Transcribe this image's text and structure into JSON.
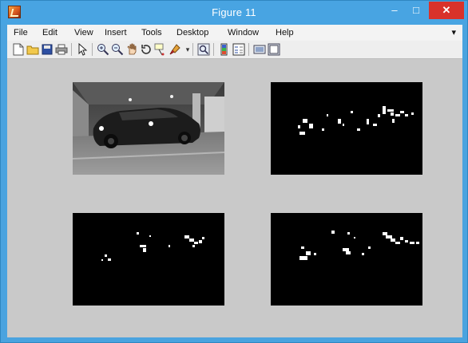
{
  "window": {
    "title": "Figure 11",
    "minimize_label": "–",
    "maximize_label": "□",
    "close_label": "✕"
  },
  "menu": {
    "items": [
      "File",
      "Edit",
      "View",
      "Insert",
      "Tools",
      "Desktop",
      "Window",
      "Help"
    ],
    "overflow_arrow": "▾"
  },
  "toolbar": {
    "icons": [
      "new-figure-icon",
      "open-file-icon",
      "save-icon",
      "print-icon",
      "edit-plot-arrow-icon",
      "zoom-in-icon",
      "zoom-out-icon",
      "pan-icon",
      "rotate-3d-icon",
      "data-cursor-icon",
      "brush-icon",
      "link-plot-icon",
      "colorbar-icon",
      "legend-icon",
      "hide-plot-tools-icon",
      "show-plot-tools-icon"
    ]
  },
  "colors": {
    "title_bar": "#48a4e2",
    "close_button": "#d9322a",
    "figure_background": "#c9c9c9",
    "axes_background": "#000000"
  },
  "figure": {
    "subplots": [
      {
        "position": "top-left",
        "content": "grayscale photo of a car in a parking garage"
      },
      {
        "position": "top-right",
        "content": "binary mask with white blobs"
      },
      {
        "position": "bottom-left",
        "content": "binary mask with white blobs"
      },
      {
        "position": "bottom-right",
        "content": "binary mask with white blobs"
      }
    ]
  }
}
